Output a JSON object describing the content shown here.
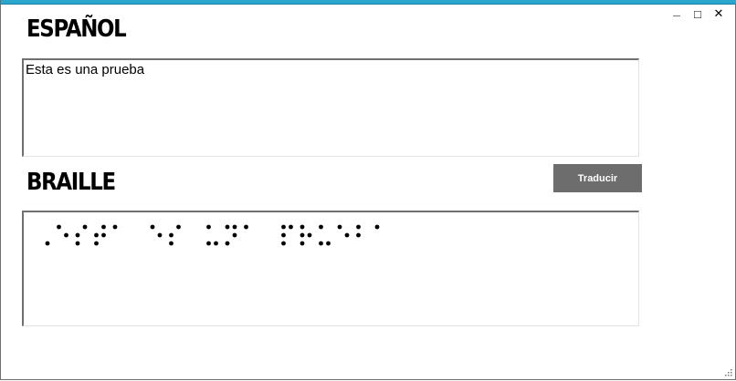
{
  "window": {
    "minimize_glyph": "_",
    "maximize_glyph": "□",
    "close_glyph": "✕"
  },
  "spanish": {
    "heading": "ESPAÑOL",
    "text": "Esta es una prueba"
  },
  "braille": {
    "heading": "BRAILLE",
    "translate_button": "Traducir",
    "output_text": "⠠⠑⠎⠞⠁ ⠑⠎ ⠥⠝⠁ ⠏⠗⠥⠑⠃⠁"
  },
  "colors": {
    "accent": "#2aa6cf",
    "button_bg": "#6d6d6d"
  }
}
